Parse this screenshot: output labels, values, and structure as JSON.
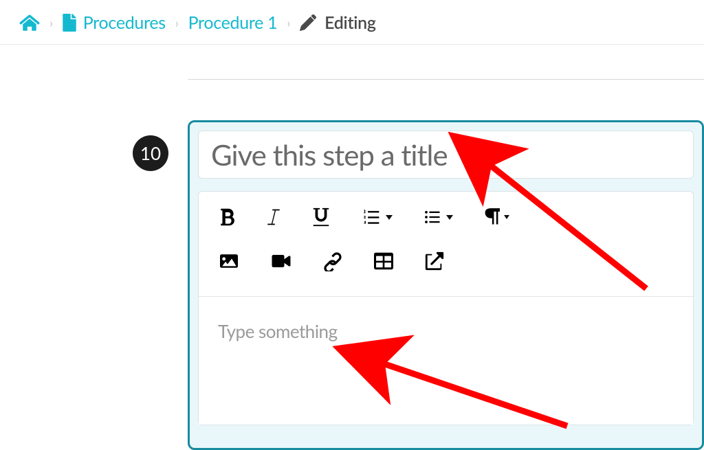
{
  "breadcrumb": {
    "procedures_label": "Procedures",
    "procedure_label": "Procedure 1",
    "current_label": "Editing"
  },
  "step": {
    "number": "10",
    "title_placeholder": "Give this step a title",
    "body_placeholder": "Type something"
  },
  "toolbar": {
    "bold": "Bold",
    "italic": "Italic",
    "underline": "Underline",
    "ordered_list": "Ordered List",
    "unordered_list": "Unordered List",
    "paragraph": "Paragraph Format",
    "image": "Insert Image",
    "video": "Insert Video",
    "link": "Insert Link",
    "table": "Insert Table",
    "open": "Open Link"
  }
}
